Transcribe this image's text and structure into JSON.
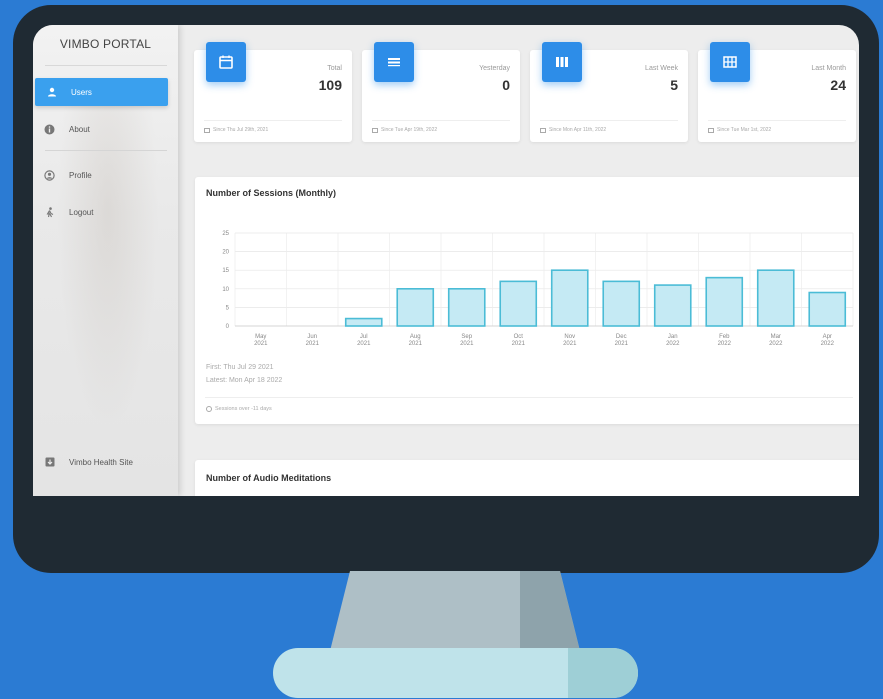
{
  "sidebar": {
    "brand": "VIMBO PORTAL",
    "items": [
      {
        "label": "Users",
        "icon": "user-icon"
      },
      {
        "label": "About",
        "icon": "info-icon"
      },
      {
        "label": "Profile",
        "icon": "profile-icon"
      },
      {
        "label": "Logout",
        "icon": "logout-icon"
      }
    ],
    "footer_link": {
      "label": "Vimbo Health Site",
      "icon": "external-site-icon"
    }
  },
  "stats": [
    {
      "label": "Total",
      "value": "109",
      "since": "Since Thu Jul 29th, 2021",
      "icon": "calendar-icon"
    },
    {
      "label": "Yesterday",
      "value": "0",
      "since": "Since Tue Apr 19th, 2022",
      "icon": "menu-lines-icon"
    },
    {
      "label": "Last Week",
      "value": "5",
      "since": "Since Mon Apr 11th, 2022",
      "icon": "columns-icon"
    },
    {
      "label": "Last Month",
      "value": "24",
      "since": "Since Tue Mar 1st, 2022",
      "icon": "grid-icon"
    }
  ],
  "sessions_card": {
    "title": "Number of Sessions (Monthly)",
    "first": "First: Thu Jul 29 2021",
    "latest": "Latest: Mon Apr 18 2022",
    "footer": "Sessions over -11 days"
  },
  "audio_card": {
    "title": "Number of Audio Meditations"
  },
  "chart_data": {
    "type": "bar",
    "categories": [
      [
        "May",
        "2021"
      ],
      [
        "Jun",
        "2021"
      ],
      [
        "Jul",
        "2021"
      ],
      [
        "Aug",
        "2021"
      ],
      [
        "Sep",
        "2021"
      ],
      [
        "Oct",
        "2021"
      ],
      [
        "Nov",
        "2021"
      ],
      [
        "Dec",
        "2021"
      ],
      [
        "Jan",
        "2022"
      ],
      [
        "Feb",
        "2022"
      ],
      [
        "Mar",
        "2022"
      ],
      [
        "Apr",
        "2022"
      ]
    ],
    "values": [
      0,
      0,
      2,
      10,
      10,
      12,
      15,
      12,
      11,
      13,
      15,
      9
    ],
    "yticks": [
      0,
      5,
      10,
      15,
      20,
      25
    ],
    "ylim": [
      0,
      25
    ],
    "bar_fill": "#c5eaf4",
    "bar_stroke": "#4bbcd6",
    "grid": true
  },
  "colors": {
    "accent": "#2d8de8",
    "active_nav": "#3aa0ee"
  }
}
